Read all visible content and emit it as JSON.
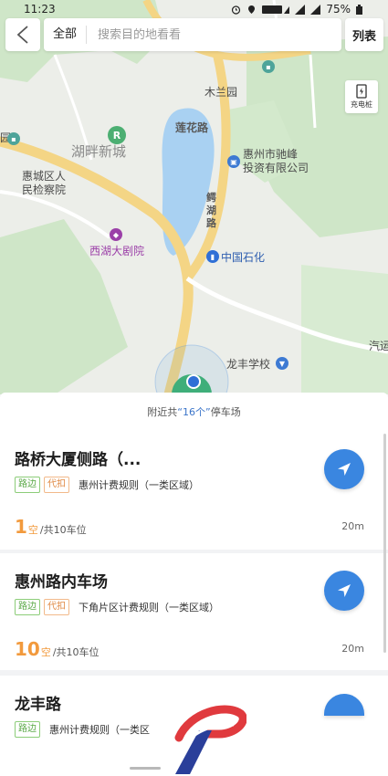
{
  "status_bar": {
    "time": "11:23",
    "battery": "75%"
  },
  "search": {
    "scope": "全部",
    "placeholder": "搜索目的地看看",
    "list_label": "列表"
  },
  "map": {
    "charge_label": "充电桩",
    "labels": {
      "mulanyuan": "木兰园",
      "lianhualu": "莲花路",
      "huhanxincheng": "湖畔新城",
      "huizhou_chifeng": "惠州市驰峰\n投资有限公司",
      "jianchayuan": "惠城区人\n民检察院",
      "ehulu": "鳄\n湖\n路",
      "xihu_theatre": "西湖大剧院",
      "sinopec": "中国石化",
      "longfeng_school": "龙丰学校",
      "bus": "汽运",
      "edge_left": "园"
    }
  },
  "results": {
    "summary_prefix": "附近共 ",
    "summary_count": "“16个”",
    "summary_suffix": " 停车场",
    "items": [
      {
        "name": "路桥大厦侧路（...",
        "tags": [
          "路边",
          "代扣"
        ],
        "rule": "惠州计费规则（一类区域）",
        "available": "1",
        "unit": "空",
        "total": "/共10车位",
        "distance": "20m"
      },
      {
        "name": "惠州路内车场",
        "tags": [
          "路边",
          "代扣"
        ],
        "rule": "下角片区计费规则（一类区域）",
        "available": "10",
        "unit": "空",
        "total": "/共10车位",
        "distance": "20m"
      },
      {
        "name": "龙丰路",
        "tags": [
          "路边"
        ],
        "rule": "惠州计费规则（一类区",
        "available": "",
        "unit": "",
        "total": "",
        "distance": ""
      }
    ]
  },
  "colors": {
    "accent": "#3a86e0",
    "available": "#f29a3d",
    "tag_green": "#5aa846",
    "tag_orange": "#e08a45"
  }
}
